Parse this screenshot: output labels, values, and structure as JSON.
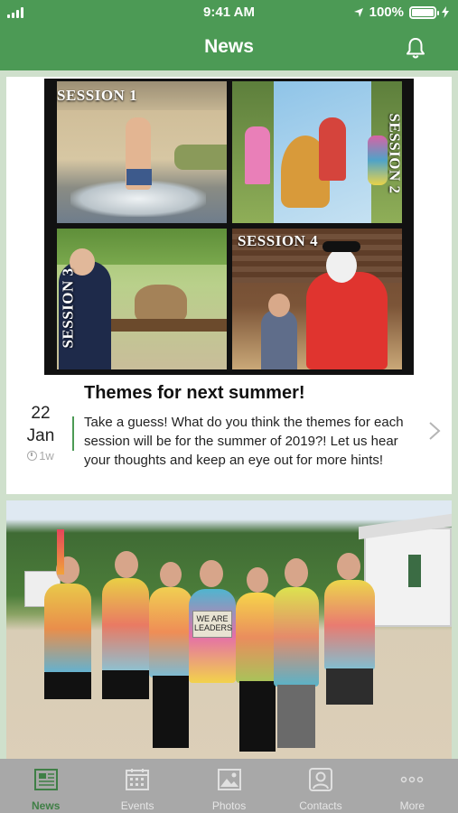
{
  "status_bar": {
    "time": "9:41 AM",
    "battery": "100%",
    "battery_level": 1.0
  },
  "header": {
    "title": "News",
    "bell_icon": "bell-icon"
  },
  "feed": {
    "posts": [
      {
        "image_labels": [
          "SESSION 1",
          "SESSION 2",
          "SESSION 3",
          "SESSION 4"
        ],
        "sign_text": "WE ARE LEADERS",
        "day": "22",
        "month": "Jan",
        "age": "1w",
        "title": "Themes for next summer!",
        "body": "Take a guess! What do you think the themes for each session will be for the summer of 2019?! Let us hear your thoughts and keep an eye out for more hints!"
      }
    ]
  },
  "tabs": [
    {
      "label": "News",
      "icon": "newspaper-icon",
      "active": true
    },
    {
      "label": "Events",
      "icon": "calendar-icon",
      "active": false
    },
    {
      "label": "Photos",
      "icon": "photo-icon",
      "active": false
    },
    {
      "label": "Contacts",
      "icon": "contact-card-icon",
      "active": false
    },
    {
      "label": "More",
      "icon": "more-dots-icon",
      "active": false
    }
  ],
  "colors": {
    "brand_green": "#4c9a55",
    "background": "#cfe0cc",
    "tab_bar": "#a8a8a8"
  }
}
